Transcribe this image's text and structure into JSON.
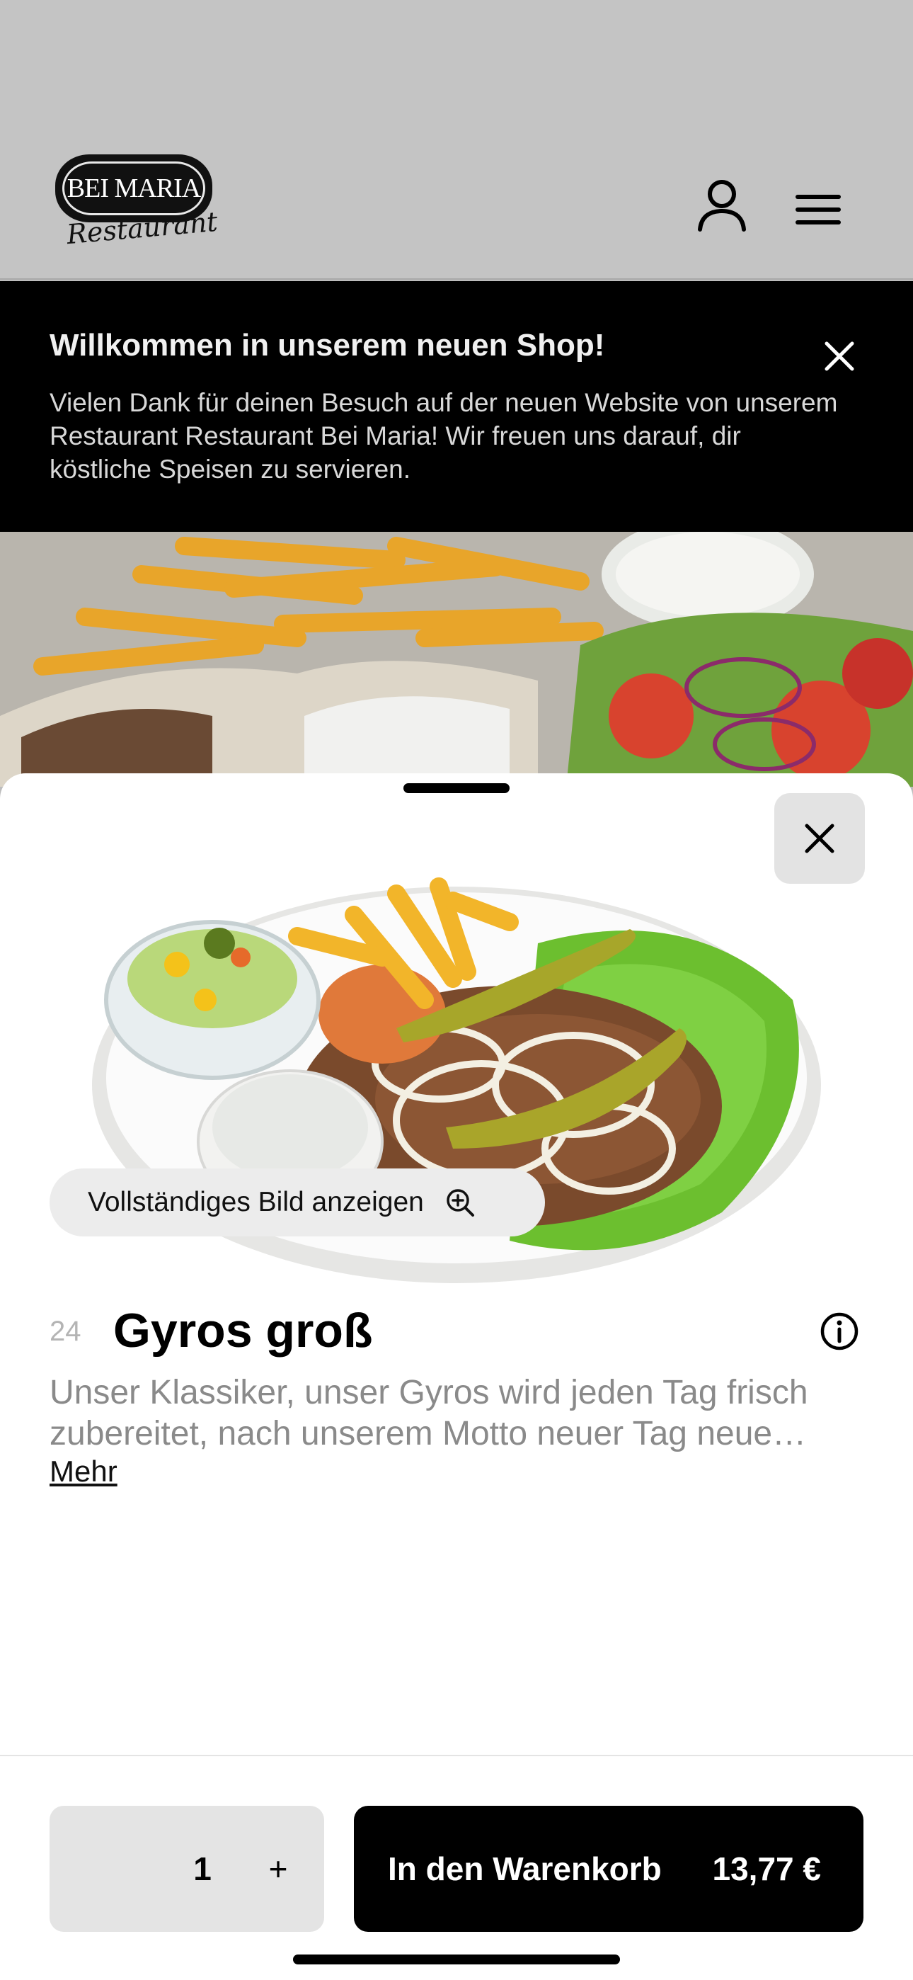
{
  "header": {
    "logo_text": "BEI MARIA",
    "logo_script": "Restaurant"
  },
  "banner": {
    "title": "Willkommen in unserem neuen Shop!",
    "text": "Vielen Dank für deinen Besuch auf der neuen Website von unserem Restaurant Restaurant Bei Maria! Wir freuen uns darauf, dir köstliche Speisen zu servieren."
  },
  "product": {
    "view_full_label": "Vollständiges Bild anzeigen",
    "number": "24",
    "name": "Gyros groß",
    "description": "Unser Klassiker, unser Gyros wird jeden Tag frisch zubereitet, nach unserem Motto neuer Tag neue…",
    "more_label": "Mehr"
  },
  "footer": {
    "quantity": "1",
    "plus_label": "+",
    "cart_label": "In den Warenkorb",
    "price": "13,77 €"
  },
  "colors": {
    "header_bg": "#c4c4c4",
    "banner_bg": "#000000",
    "cart_button": "#000000",
    "qty_bg": "#e4e4e4"
  },
  "icons": [
    "user-icon",
    "menu-icon",
    "close-icon",
    "zoom-in-icon",
    "info-icon"
  ]
}
